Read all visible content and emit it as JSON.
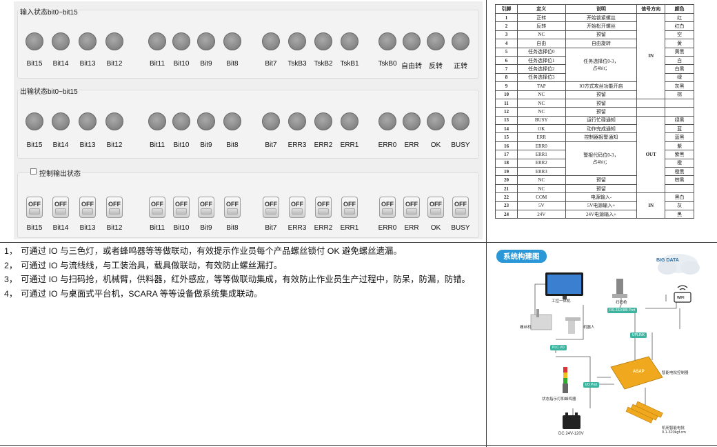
{
  "io_panel": {
    "input_group_title": "输入状态bit0~bit15",
    "output_group_title": "出输状态bit0~bit15",
    "control_group_title": "控制输出状态",
    "input_labels": [
      "Bit15",
      "Bit14",
      "Bit13",
      "Bit12",
      "Bit11",
      "Bit10",
      "Bit9",
      "Bit8",
      "Bit7",
      "TskB3",
      "TskB2",
      "TskB1",
      "TskB0",
      "自由转",
      "反转",
      "正转"
    ],
    "output_labels": [
      "Bit15",
      "Bit14",
      "Bit13",
      "Bit12",
      "Bit11",
      "Bit10",
      "Bit9",
      "Bit8",
      "Bit7",
      "ERR3",
      "ERR2",
      "ERR1",
      "ERR0",
      "ERR",
      "OK",
      "BUSY"
    ],
    "control_labels": [
      "Bit15",
      "Bit14",
      "Bit13",
      "Bit12",
      "Bit11",
      "Bit10",
      "Bit9",
      "Bit8",
      "Bit7",
      "ERR3",
      "ERR2",
      "ERR1",
      "ERR0",
      "ERR",
      "OK",
      "BUSY"
    ],
    "switch_text": "OFF"
  },
  "pin_table": {
    "headers": [
      "引脚",
      "定义",
      "说明",
      "信号方向",
      "颜色"
    ],
    "direction_in": "IN",
    "direction_out": "OUT",
    "rows": [
      {
        "pin": "1",
        "def": "正转",
        "desc": "开始锁紧螺丝",
        "color": "红"
      },
      {
        "pin": "2",
        "def": "反转",
        "desc": "开始松开螺丝",
        "color": "红白"
      },
      {
        "pin": "3",
        "def": "NC",
        "desc": "预留",
        "color": "空"
      },
      {
        "pin": "4",
        "def": "自由",
        "desc": "自由旋转",
        "color": "黄"
      },
      {
        "pin": "5",
        "def": "任务选择位0",
        "color": "黄黑"
      },
      {
        "pin": "6",
        "def": "任务选择位1",
        "color": "白"
      },
      {
        "pin": "7",
        "def": "任务选择位2",
        "color": "白黑"
      },
      {
        "pin": "8",
        "def": "任务选择位3",
        "color": "绿"
      },
      {
        "pin": "9",
        "def": "TAP",
        "desc": "IO方式攻丝功能开启",
        "color": "灰黑"
      },
      {
        "pin": "10",
        "def": "NC",
        "desc": "预留",
        "color": "棕"
      },
      {
        "pin": "11",
        "def": "NC",
        "desc": "预留",
        "color": ""
      },
      {
        "pin": "12",
        "def": "NC",
        "desc": "预留",
        "color": ""
      },
      {
        "pin": "13",
        "def": "BUSY",
        "desc": "运行忙碌通知",
        "color": "绿黑"
      },
      {
        "pin": "14",
        "def": "OK",
        "desc": "动作完成通知",
        "color": "蓝"
      },
      {
        "pin": "15",
        "def": "ERR",
        "desc": "控制器报警通知",
        "color": "蓝黑"
      },
      {
        "pin": "16",
        "def": "ERR0",
        "color": "紫"
      },
      {
        "pin": "17",
        "def": "ERR1",
        "color": "紫黑"
      },
      {
        "pin": "18",
        "def": "ERR2",
        "color": "橙"
      },
      {
        "pin": "19",
        "def": "ERR3",
        "color": "橙黑"
      },
      {
        "pin": "20",
        "def": "NC",
        "desc": "预留",
        "color": "棕黑"
      },
      {
        "pin": "21",
        "def": "NC",
        "desc": "预留",
        "color": ""
      },
      {
        "pin": "22",
        "def": "COM",
        "desc": "电源输入-",
        "color": "黑白"
      },
      {
        "pin": "23",
        "def": "5V",
        "desc": "5V电源输入+",
        "color": "灰"
      },
      {
        "pin": "24",
        "def": "24V",
        "desc": "24V电源输入+",
        "color": "黑"
      }
    ],
    "task_desc_line1": "任务选择位0-3，",
    "task_desc_line2": "占4bit；",
    "err_desc_line1": "警报代码位0-3，",
    "err_desc_line2": "占4bit；"
  },
  "notes": [
    {
      "num": "1，",
      "text": "可通过 IO 与三色灯，或者蜂鸣器等等做联动，有效提示作业员每个产品螺丝锁付 OK 避免螺丝遗漏。"
    },
    {
      "num": "2，",
      "text": "可通过 IO 与流线线，与工装治具，载具做联动，有效防止螺丝漏打。"
    },
    {
      "num": "3，",
      "text": "可通过 IO 与扫码抢，机械臂，供料器，红外感应，等等做联动集成，有效防止作业员生产过程中，防呆，防漏，防错。"
    },
    {
      "num": "4，",
      "text": "可通过 IO 与桌面式平台机，SCARA 等等设备做系统集成联动。"
    }
  ],
  "diagram": {
    "title": "系统构建图",
    "big_data": "BIG DATA",
    "panel_pc": "工控一体机",
    "scanner": "扫码枪",
    "rs232": "RS-232/485 Port",
    "uplink": "UPLINK",
    "screw_machine": "螺丝机",
    "robot": "机器人",
    "plc_io": "PLC I/O",
    "io_port": "I/O Port",
    "controller": "智能电批控制器",
    "status_light": "状态指示灯和蜂鸣器",
    "power": "DC 24V-120V",
    "driver_line1": "机用智能电批",
    "driver_line2": "0.1-320kgf.cm",
    "brand": "ASAP",
    "wifi": "WIFI"
  }
}
